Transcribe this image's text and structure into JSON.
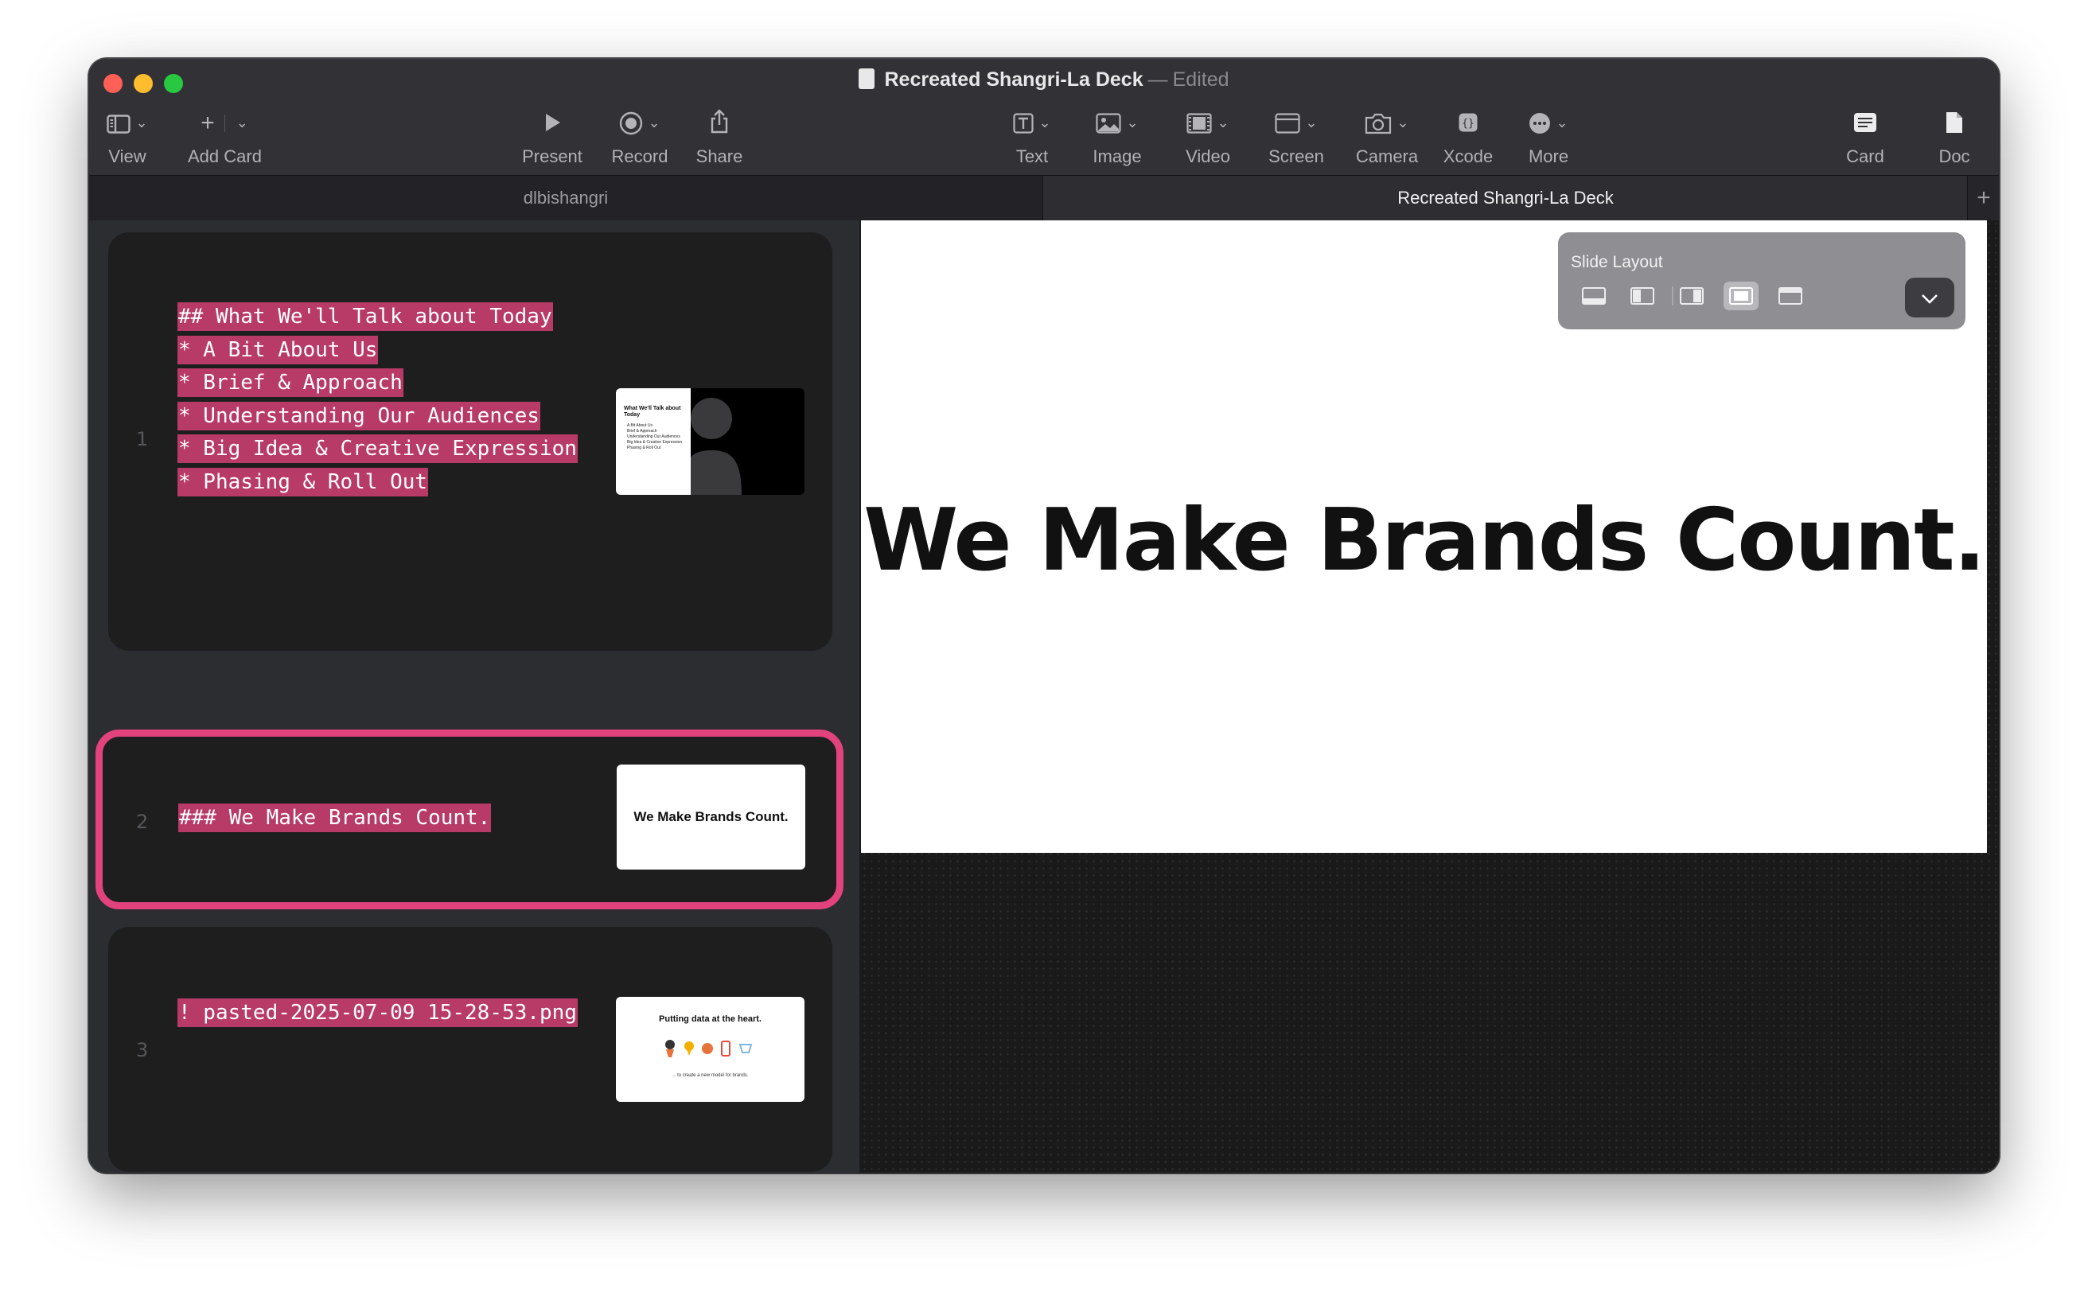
{
  "window": {
    "title": "Recreated Shangri-La Deck",
    "separator": "—",
    "status": "Edited"
  },
  "toolbar": {
    "view": "View",
    "add_card": "Add Card",
    "present": "Present",
    "record": "Record",
    "share": "Share",
    "text": "Text",
    "image": "Image",
    "video": "Video",
    "screen": "Screen",
    "camera": "Camera",
    "xcode": "Xcode",
    "more": "More",
    "card": "Card",
    "doc": "Doc"
  },
  "tabs": [
    {
      "label": "dlbishangri",
      "active": false
    },
    {
      "label": "Recreated Shangri-La Deck",
      "active": true
    }
  ],
  "cards": [
    {
      "number": "1",
      "lines": [
        "## What We'll Talk about Today",
        "* A Bit About Us",
        "* Brief & Approach",
        "* Understanding Our Audiences",
        "* Big Idea & Creative Expression",
        "* Phasing & Roll Out"
      ],
      "thumb": {
        "title": "What We'll Talk about Today",
        "bullets": [
          "A Bit About Us",
          "Brief & Approach",
          "Understanding Our Audiences",
          "Big Idea & Creative Expression",
          "Phasing & Roll Out"
        ]
      }
    },
    {
      "number": "2",
      "lines": [
        "### We Make Brands Count."
      ],
      "selected": true,
      "thumb": {
        "title": "We Make Brands Count."
      }
    },
    {
      "number": "3",
      "lines": [
        "! pasted-2025-07-09 15-28-53.png"
      ],
      "thumb": {
        "title": "Putting data at the heart.",
        "caption": "... to create a new model for brands."
      }
    }
  ],
  "slide": {
    "title": "We Make Brands Count."
  },
  "layout_panel": {
    "title": "Slide Layout",
    "active_option": 4,
    "options": [
      "bottom-bar-layout",
      "left-panel-layout",
      "right-panel-layout",
      "centered-layout",
      "top-bar-layout"
    ]
  },
  "colors": {
    "accent": "#e2437d",
    "highlight": "#b83a66"
  }
}
